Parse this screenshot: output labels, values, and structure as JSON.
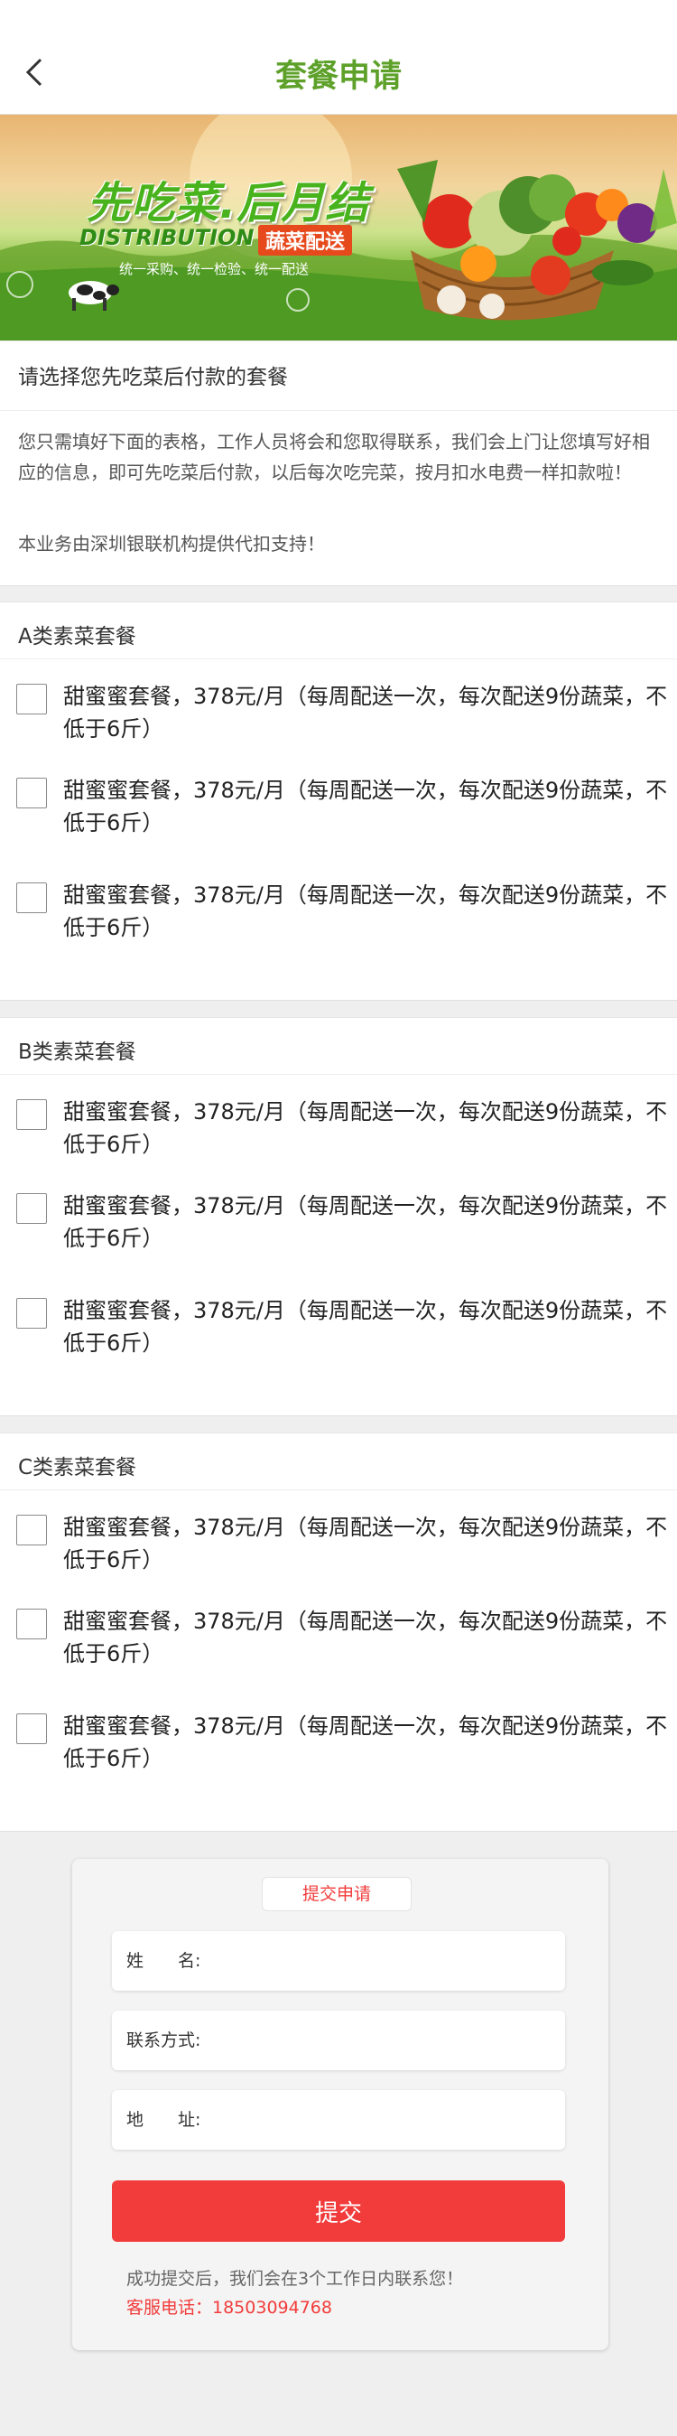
{
  "header": {
    "title": "套餐申请",
    "back_icon": "chevron-left-icon"
  },
  "banner": {
    "headline": "先吃菜.后月结",
    "sub": "DISTRIBUTION",
    "badge": "蔬菜配送",
    "tagline": "统一采购、统一检验、统一配送"
  },
  "intro": {
    "title": "请选择您先吃菜后付款的套餐",
    "description": "您只需填好下面的表格，工作人员将会和您取得联系，我们会上门让您填写好相应的信息，即可先吃菜后付款，以后每次吃完菜，按月扣水电费一样扣款啦！",
    "note": "本业务由深圳银联机构提供代扣支持！"
  },
  "packages": [
    {
      "title": "A类素菜套餐",
      "options": [
        "甜蜜蜜套餐，378元/月（每周配送一次，每次配送9份蔬菜，不低于6斤）",
        "甜蜜蜜套餐，378元/月（每周配送一次，每次配送9份蔬菜，不低于6斤）",
        "甜蜜蜜套餐，378元/月（每周配送一次，每次配送9份蔬菜，不低于6斤）"
      ]
    },
    {
      "title": "B类素菜套餐",
      "options": [
        "甜蜜蜜套餐，378元/月（每周配送一次，每次配送9份蔬菜，不低于6斤）",
        "甜蜜蜜套餐，378元/月（每周配送一次，每次配送9份蔬菜，不低于6斤）",
        "甜蜜蜜套餐，378元/月（每周配送一次，每次配送9份蔬菜，不低于6斤）"
      ]
    },
    {
      "title": "C类素菜套餐",
      "options": [
        "甜蜜蜜套餐，378元/月（每周配送一次，每次配送9份蔬菜，不低于6斤）",
        "甜蜜蜜套餐，378元/月（每周配送一次，每次配送9份蔬菜，不低于6斤）",
        "甜蜜蜜套餐，378元/月（每周配送一次，每次配送9份蔬菜，不低于6斤）"
      ]
    }
  ],
  "form": {
    "heading": "提交申请",
    "name_label": "姓　　名:",
    "phone_label": "联系方式:",
    "address_label": "地　　址:",
    "name_value": "",
    "phone_value": "",
    "address_value": "",
    "submit_label": "提交",
    "success_note": "成功提交后，我们会在3个工作日内联系您！",
    "hotline": "客服电话：18503094768"
  },
  "colors": {
    "title_green": "#5ea12a",
    "accent_red": "#f23c3c",
    "page_bg": "#efefef"
  }
}
